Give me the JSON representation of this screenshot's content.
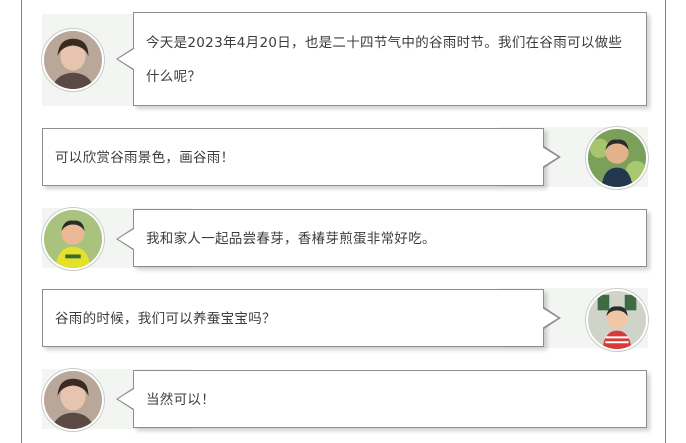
{
  "messages": [
    {
      "side": "left",
      "speaker": "teacher",
      "text": "今天是2023年4月20日，也是二十四节气中的谷雨时节。我们在谷雨可以做些什么呢？"
    },
    {
      "side": "right",
      "speaker": "child-1",
      "text": "可以欣赏谷雨景色，画谷雨！"
    },
    {
      "side": "left",
      "speaker": "child-2",
      "text": "我和家人一起品尝春芽，香椿芽煎蛋非常好吃。"
    },
    {
      "side": "right",
      "speaker": "child-3",
      "text": "谷雨的时候，我们可以养蚕宝宝吗？"
    },
    {
      "side": "left",
      "speaker": "teacher",
      "text": "当然可以！"
    }
  ],
  "colors": {
    "frame": "#5e9a6a",
    "bubble_border": "#8e8e8e",
    "stripe": "#f3f5f3",
    "text": "#3c3c3c"
  }
}
